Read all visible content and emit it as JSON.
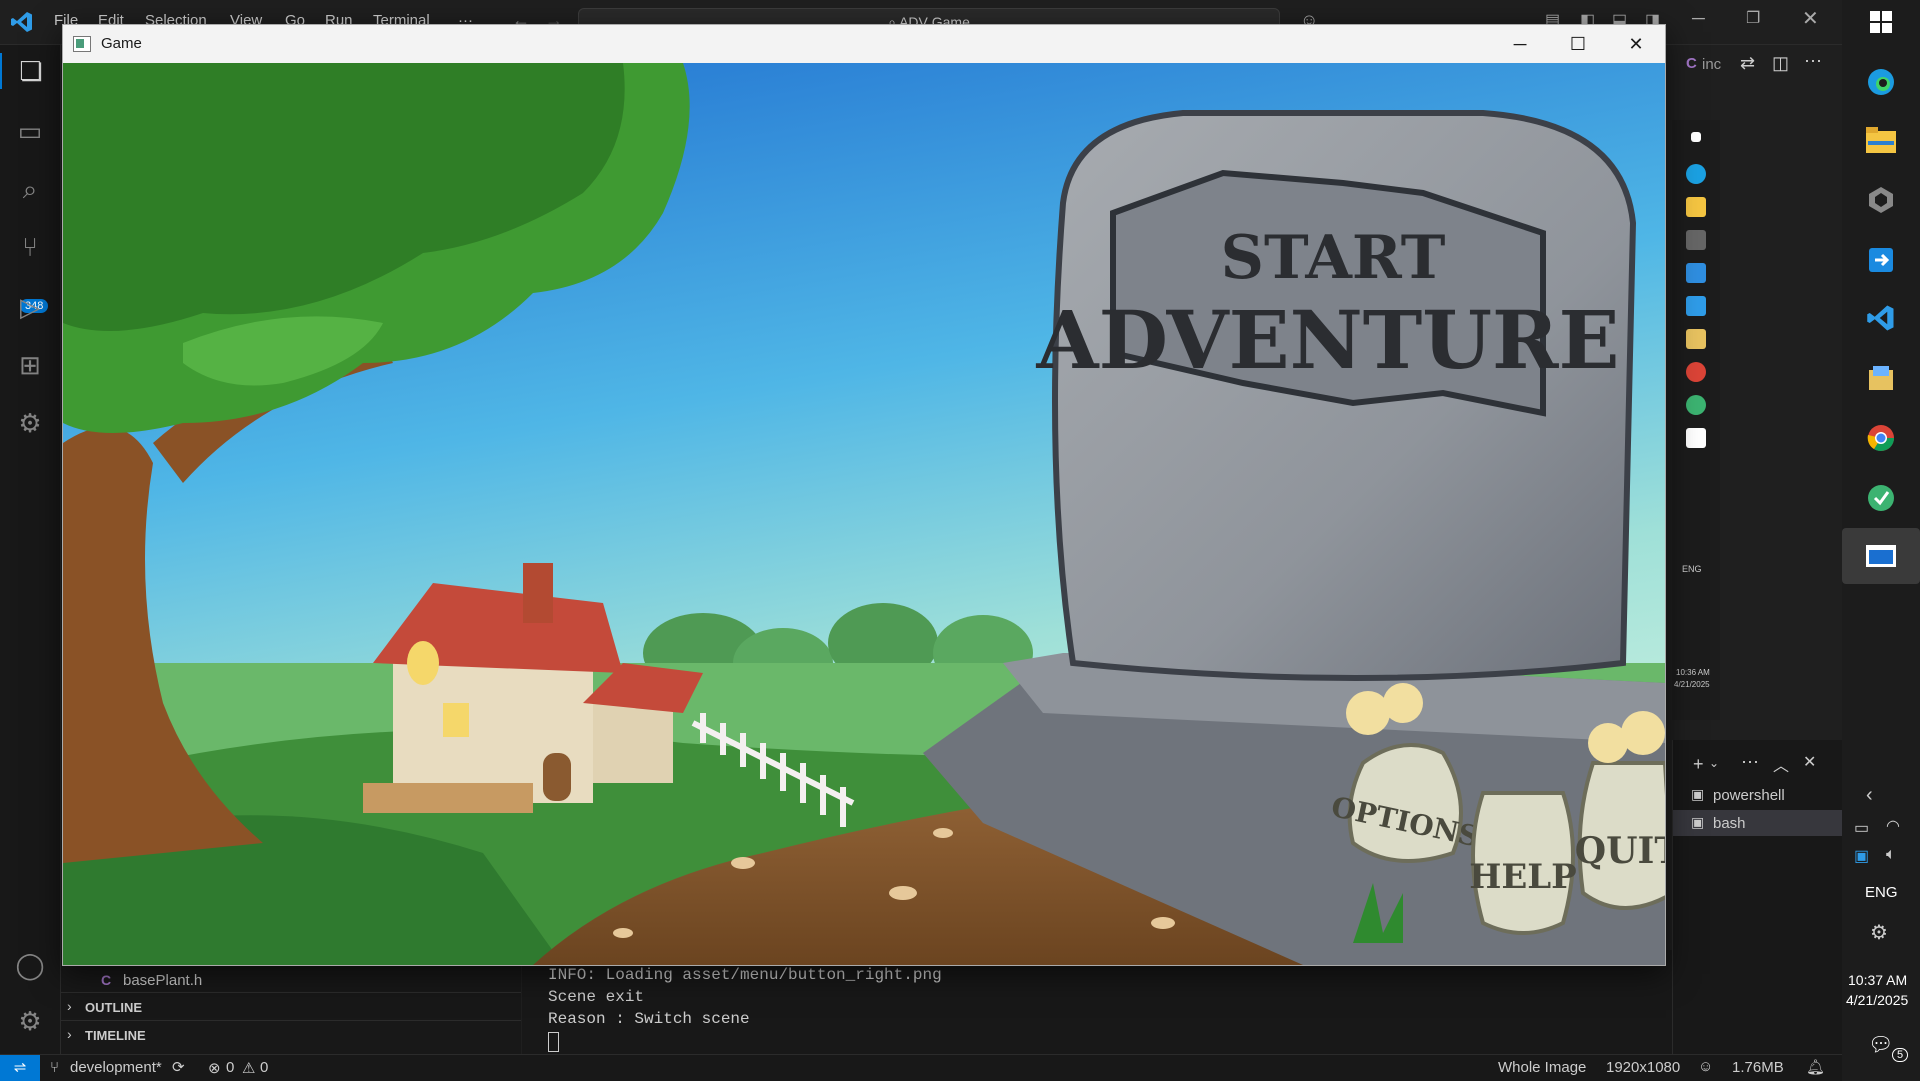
{
  "vscode": {
    "menu": [
      "File",
      "Edit",
      "Selection",
      "View",
      "Go",
      "Run",
      "Terminal",
      "···"
    ],
    "search_text": "ADV Game",
    "scm_badge": "348",
    "sidebar": {
      "file_item": "basePlant.h",
      "file_icon_letter": "C",
      "outline_label": "OUTLINE",
      "timeline_label": "TIMELINE"
    },
    "terminal_lines": [
      "INFO: Loading asset/menu/button_right.png",
      "Scene exit",
      "Reason : Switch scene"
    ],
    "terminal_tabs": [
      "powershell",
      "bash"
    ],
    "editor_tab_partial": "inc",
    "editor_tab_letter": "C",
    "statusbar": {
      "branch": "development*",
      "errors": "0",
      "warnings": "0",
      "view_mode": "Whole Image",
      "resolution": "1920x1080",
      "file_size": "1.76MB"
    }
  },
  "game_window": {
    "title": "Game",
    "tombstone_line1": "START",
    "tombstone_line2": "ADVENTURE",
    "vase_options": "OPTIONS",
    "vase_help": "HELP",
    "vase_quit": "QUIT"
  },
  "taskbar": {
    "language": "ENG",
    "time": "10:37 AM",
    "date": "4/21/2025",
    "notifications": "5",
    "mini_language": "ENG",
    "mini_time": "10:36 AM",
    "mini_date": "4/21/2025"
  },
  "colors": {
    "accent": "#0078d4",
    "sky_top": "#1f6fd0",
    "sky_bottom": "#9fe0d8",
    "tombstone": "#8f949b"
  }
}
